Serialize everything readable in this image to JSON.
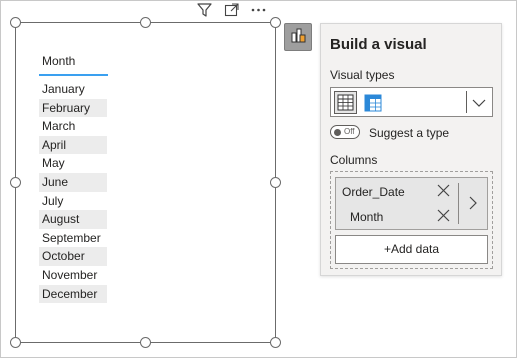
{
  "visual": {
    "column_header": "Month",
    "rows": [
      "January",
      "February",
      "March",
      "April",
      "May",
      "June",
      "July",
      "August",
      "September",
      "October",
      "November",
      "December"
    ],
    "header_icons": [
      "filter-icon",
      "focus-mode-icon",
      "more-options-icon"
    ]
  },
  "build_panel": {
    "title": "Build a visual",
    "visual_types_label": "Visual types",
    "visual_type_icons": [
      "table-icon",
      "matrix-icon"
    ],
    "suggest_toggle_state": "Off",
    "suggest_label": "Suggest a type",
    "columns_label": "Columns",
    "fields": [
      "Order_Date",
      "Month"
    ],
    "add_data_label": "+Add data"
  },
  "colors": {
    "accent_underline": "#3aa0f0",
    "panel_bg": "#f3f2f1",
    "matrix_icon": "#2b88d8"
  }
}
